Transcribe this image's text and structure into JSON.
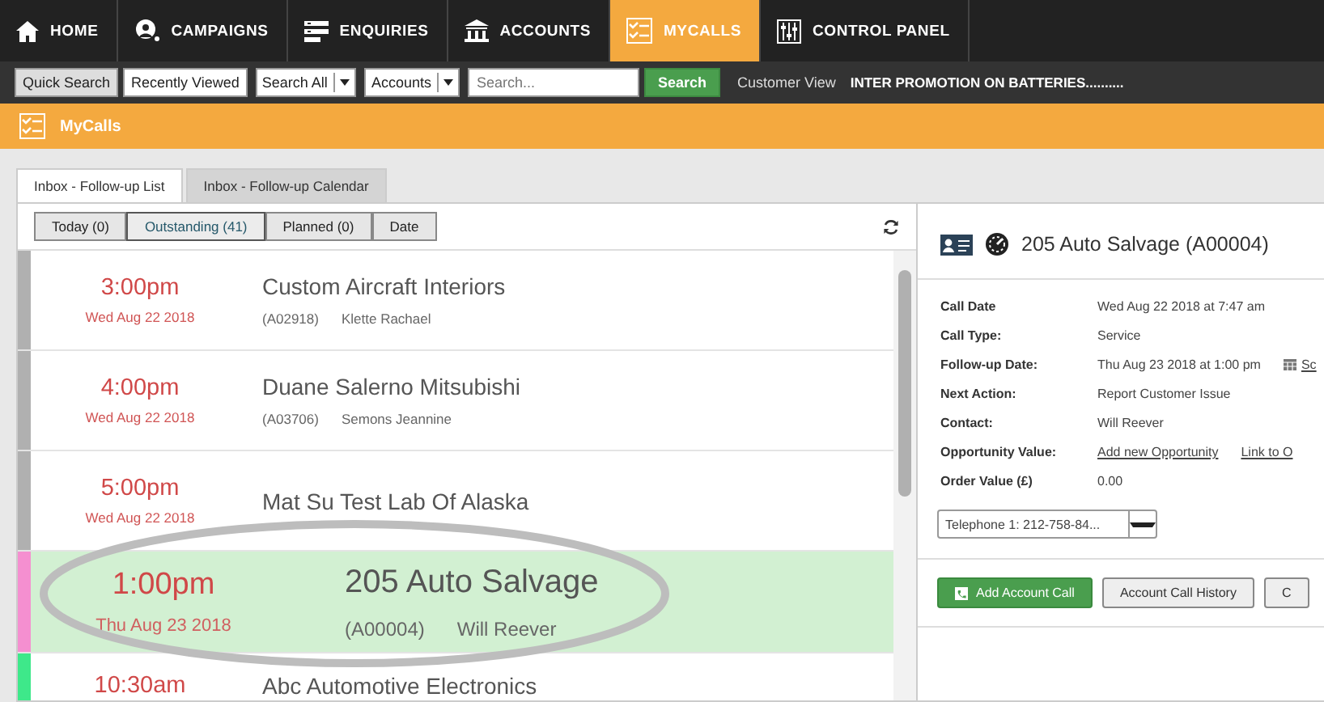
{
  "nav": [
    {
      "label": "HOME",
      "selected": false
    },
    {
      "label": "CAMPAIGNS",
      "selected": false
    },
    {
      "label": "ENQUIRIES",
      "selected": false
    },
    {
      "label": "ACCOUNTS",
      "selected": false
    },
    {
      "label": "MYCALLS",
      "selected": true
    },
    {
      "label": "CONTROL PANEL",
      "selected": false
    }
  ],
  "search_bar": {
    "modes": [
      {
        "label": "Quick Search",
        "selected": true
      },
      {
        "label": "Recently Viewed",
        "selected": false
      }
    ],
    "dropdowns": [
      "Search All",
      "Accounts"
    ],
    "search": {
      "placeholder": "Search..."
    },
    "button": "Search",
    "link": "Customer View",
    "ticker": "INTER PROMOTION ON BATTERIES.........."
  },
  "page_title": "MyCalls",
  "tabs": [
    {
      "label": "Inbox - Follow-up List",
      "selected": true
    },
    {
      "label": "Inbox - Follow-up Calendar",
      "selected": false
    }
  ],
  "filters": [
    {
      "label": "Today (0)",
      "selected": false
    },
    {
      "label": "Outstanding (41)",
      "selected": true
    },
    {
      "label": "Planned (0)",
      "selected": false
    },
    {
      "label": "Date",
      "selected": false
    }
  ],
  "calls": [
    {
      "time": "3:00pm",
      "date": "Wed Aug 22 2018",
      "name": "Custom Aircraft Interiors",
      "code": "(A02918)",
      "contact": "Klette Rachael",
      "color": "#b0b0b0",
      "selected": false
    },
    {
      "time": "4:00pm",
      "date": "Wed Aug 22 2018",
      "name": "Duane Salerno Mitsubishi",
      "code": "(A03706)",
      "contact": "Semons Jeannine",
      "color": "#b0b0b0",
      "selected": false
    },
    {
      "time": "5:00pm",
      "date": "Wed Aug 22 2018",
      "name": "Mat Su Test Lab Of Alaska",
      "color": "#b0b0b0",
      "selected": false
    },
    {
      "time": "1:00pm",
      "date": "Thu Aug 23 2018",
      "name": "205 Auto Salvage",
      "code": "(A00004)",
      "contact": "Will Reever",
      "color": "#f58fd0",
      "selected": true
    },
    {
      "time": "10:30am",
      "name": "Abc Automotive Electronics",
      "color": "#3ee88a",
      "selected": false
    }
  ],
  "detail": {
    "title": "205 Auto Salvage (A00004)",
    "fields": [
      {
        "label": "Call Date",
        "value": "Wed Aug 22 2018 at 7:47 am"
      },
      {
        "label": "Call Type:",
        "value": "Service"
      },
      {
        "label": "Follow-up Date:",
        "value": "Thu Aug 23 2018 at 1:00 pm",
        "link": "Sc"
      },
      {
        "label": "Next Action:",
        "value": "Report Customer Issue"
      },
      {
        "label": "Contact:",
        "value": "Will Reever"
      },
      {
        "label": "Opportunity Value:",
        "value": "Add new Opportunity",
        "link": "Link to O"
      },
      {
        "label": "Order Value (£)",
        "value": "0.00"
      }
    ],
    "phone": "Telephone 1: 212-758-84...",
    "buttons": [
      {
        "label": "Add Account Call",
        "kind": "primary"
      },
      {
        "label": "Account Call History",
        "kind": "plain"
      },
      {
        "label": "C",
        "kind": "plain"
      }
    ]
  }
}
